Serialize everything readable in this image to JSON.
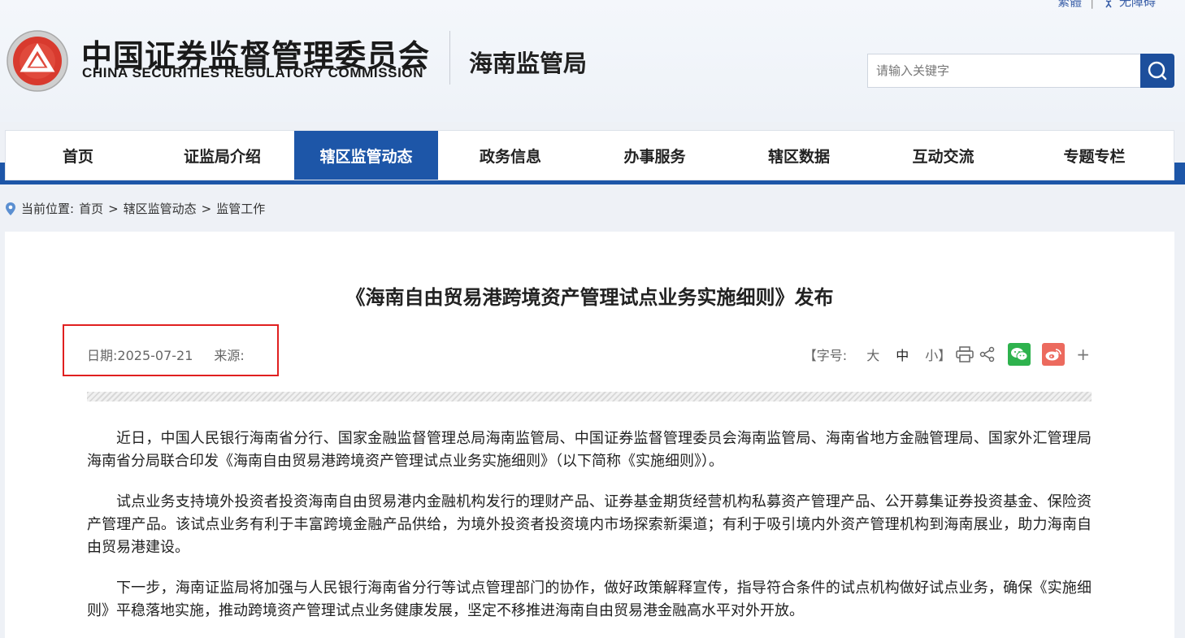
{
  "top_links": {
    "traditional": "繁體",
    "accessibility": "无障碍"
  },
  "header": {
    "cn_name": "中国证券监督管理委员会",
    "en_name": "CHINA SECURITIES REGULATORY COMMISSION",
    "bureau": "海南监管局",
    "search_placeholder": "请输入关键字"
  },
  "nav": {
    "items": [
      {
        "label": "首页",
        "active": false
      },
      {
        "label": "证监局介绍",
        "active": false
      },
      {
        "label": "辖区监管动态",
        "active": true
      },
      {
        "label": "政务信息",
        "active": false
      },
      {
        "label": "办事服务",
        "active": false
      },
      {
        "label": "辖区数据",
        "active": false
      },
      {
        "label": "互动交流",
        "active": false
      },
      {
        "label": "专题专栏",
        "active": false
      }
    ]
  },
  "breadcrumb": {
    "prefix": "当前位置:",
    "items": [
      "首页",
      "辖区监管动态",
      "监管工作"
    ],
    "separator": ">"
  },
  "article": {
    "title": "《海南自由贸易港跨境资产管理试点业务实施细则》发布",
    "date_label": "日期:",
    "date": "2025-07-21",
    "source_label": "来源:",
    "font_size_label": "【字号:",
    "font_sizes": [
      "大",
      "中",
      "小】"
    ],
    "paragraphs": [
      "近日，中国人民银行海南省分行、国家金融监督管理总局海南监管局、中国证券监督管理委员会海南监管局、海南省地方金融管理局、国家外汇管理局海南省分局联合印发《海南自由贸易港跨境资产管理试点业务实施细则》（以下简称《实施细则》）。",
      "试点业务支持境外投资者投资海南自由贸易港内金融机构发行的理财产品、证券基金期货经营机构私募资产管理产品、公开募集证券投资基金、保险资产管理产品。该试点业务有利于丰富跨境金融产品供给，为境外投资者投资境内市场探索新渠道；有利于吸引境内外资产管理机构到海南展业，助力海南自由贸易港建设。",
      "下一步，海南证监局将加强与人民银行海南省分行等试点管理部门的协作，做好政策解释宣传，指导符合条件的试点机构做好试点业务，确保《实施细则》平稳落地实施，推动跨境资产管理试点业务健康发展，坚定不移推进海南自由贸易港金融高水平对外开放。"
    ]
  },
  "colors": {
    "brand_blue": "#1d56a8",
    "highlight_red": "#e02020",
    "wechat_green": "#2eb24d",
    "weibo_red": "#ec6a5e"
  },
  "icons": [
    "accessibility-icon",
    "logo-emblem",
    "search-icon",
    "location-pin-icon",
    "print-icon",
    "share-icon",
    "wechat-icon",
    "weibo-icon",
    "plus-icon"
  ]
}
